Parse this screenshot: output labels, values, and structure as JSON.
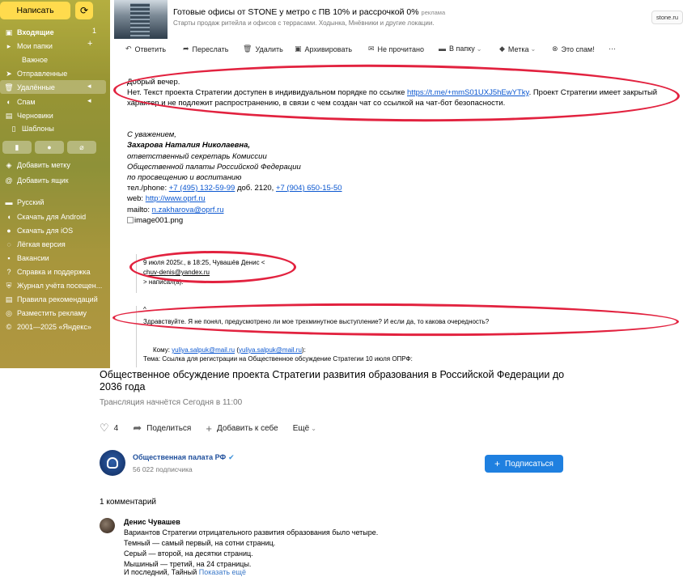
{
  "sidebar": {
    "compose_label": "Написать",
    "refresh_icon": "refresh-icon",
    "items": [
      {
        "label": "Входящие",
        "count": "1",
        "icon": "inbox-icon"
      },
      {
        "label": "Мои папки",
        "icon": "folder-icon"
      },
      {
        "label": "Важное"
      },
      {
        "label": "Отправленные",
        "icon": "send-icon"
      },
      {
        "label": "Удалённые",
        "icon": "trash-icon"
      },
      {
        "label": "Спам",
        "icon": "spam-icon"
      },
      {
        "label": "Черновики",
        "icon": "draft-icon"
      },
      {
        "label": "Шаблоны",
        "icon": "template-icon"
      }
    ],
    "add_label": "Добавить метку",
    "add_box": "Добавить ящик",
    "footer": [
      {
        "label": "Русский",
        "icon": "flag-icon"
      },
      {
        "label": "Скачать для Android",
        "icon": "android-icon"
      },
      {
        "label": "Скачать для iOS",
        "icon": "apple-icon"
      },
      {
        "label": "Лёгкая версия",
        "icon": "light-icon"
      },
      {
        "label": "Вакансии",
        "icon": "jobs-icon"
      },
      {
        "label": "Справка и поддержка",
        "icon": "help-icon"
      },
      {
        "label": "Журнал учёта посещен...",
        "icon": "journal-icon"
      },
      {
        "label": "Правила рекомендаций",
        "icon": "rules-icon"
      },
      {
        "label": "Разместить рекламу",
        "icon": "ad-icon"
      },
      {
        "label": "2001—2025 «Яндекс»",
        "icon": "copyright-icon"
      }
    ]
  },
  "ad": {
    "title": "Готовые офисы от STONE у метро с ПВ 10% и рассрочкой 0%",
    "tag": "реклама",
    "subtitle": "Старты продаж ритейла и офисов с террасами. Ходынка, Мнёвники и другие локации.",
    "domain": "stone.ru"
  },
  "toolbar": {
    "reply": "Ответить",
    "forward": "Переслать",
    "delete": "Удалить",
    "archive": "Архивировать",
    "unread": "Не прочитано",
    "to_folder": "В папку",
    "label": "Метка",
    "spam": "Это спам!",
    "more": "···"
  },
  "email": {
    "greeting": "Добрый вечер.",
    "line1_pre": "Нет. Текст проекта Стратегии доступен в индивидуальном порядке по ссылке ",
    "line1_link": "https://t.me/+mmS01UXJ5hEwYTky",
    "line1_post": ". Проект Стратегии имеет закрытый",
    "line2": "характер и не подлежит распространению, в связи с чем создан чат со ссылкой на чат-бот безопасности.",
    "regards": "С уважением,",
    "name": "Захарова Наталия Николаевна,",
    "pos1": "ответственный секретарь Комиссии",
    "pos2": "Общественной палаты Российской Федерации",
    "pos3": "по просвещению и воспитанию",
    "tel_label": "тел./phone: ",
    "tel1": "+7 (495) 132-59-99",
    "tel_ext": " доб. 2120, ",
    "tel2": "+7 (904) 650-15-50",
    "web_label": "web: ",
    "web": "http://www.oprf.ru",
    "mail_label": "mailto: ",
    "mail": "n.zakharova@oprf.ru",
    "image": "image001.png",
    "quote_header": "9 июля 2025г., в 18:25, Чувашёв Денис <",
    "quote_email": "chuv-denis@yandex.ru",
    "quote_wrote": "> написал(а):",
    "quote_caret": "^",
    "quote_text": "Здравствуйте. Я не понял, предусмотрено ли мое трехминутное выступление? И если да, то какова очередность?",
    "to_label": "Кому: ",
    "to_email": "yuliya.salpuk@mail.ru",
    "to_paren_open": " (",
    "to_email2": "yuliya.salpuk@mail.ru",
    "to_paren_close": "):",
    "subject": "Тема: Ссылка для регистрации на Общественное обсуждение Стратегии 10 июля ОПРФ:"
  },
  "post": {
    "title": "Общественное обсуждение проекта Стратегии развития образования в Российской Федерации до 2036 года",
    "subtitle": "Трансляция начнётся Сегодня в 11:00",
    "likes": "4",
    "share": "Поделиться",
    "save": "Добавить к себе",
    "more": "Ещё"
  },
  "channel": {
    "name": "Общественная палата РФ",
    "subscribers": "56 022 подписчика",
    "subscribe": "Подписаться"
  },
  "comments": {
    "count_label": "1 комментарий",
    "author": "Денис Чувашев",
    "lines": [
      "Вариантов Стратегии отрицательного развития образования было четыре.",
      "Темный — самый первый, на сотни страниц.",
      "Серый — второй, на десятки страниц.",
      "Мышиный — третий, на 24 страницы.",
      "И последний, Тайный"
    ],
    "show_more": "Показать ещё"
  }
}
